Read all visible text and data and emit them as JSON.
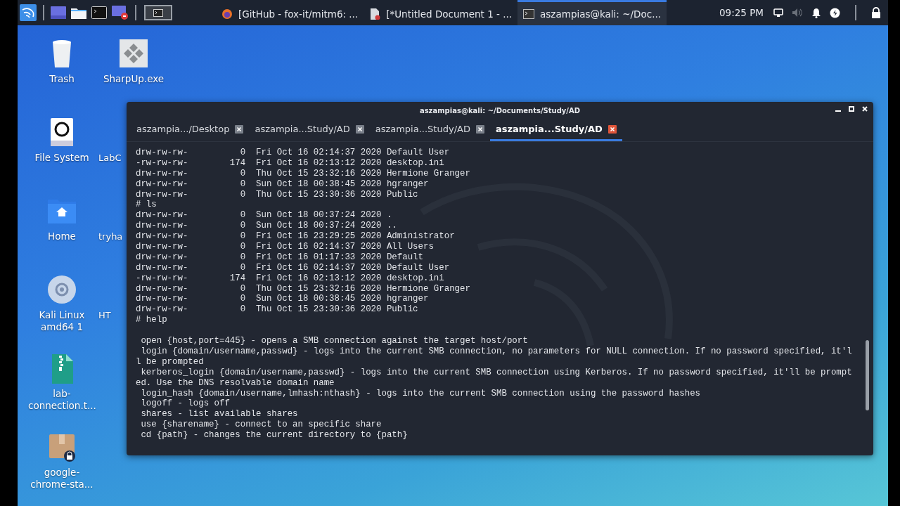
{
  "taskbar": {
    "tasks": [
      {
        "kind": "browser",
        "title": "[GitHub - fox-it/mitm6: ...",
        "selected": false
      },
      {
        "kind": "document",
        "title": "[*Untitled Document 1 - ...",
        "selected": false
      },
      {
        "kind": "terminal",
        "title": "aszampias@kali: ~/Doc...",
        "selected": true
      }
    ],
    "clock": "09:25 PM",
    "volume_muted": true
  },
  "desktop": {
    "column_1": [
      {
        "kind": "trash",
        "label": "Trash"
      },
      {
        "kind": "drive",
        "label": "File System"
      },
      {
        "kind": "home",
        "label": "Home"
      },
      {
        "kind": "disc",
        "label": "Kali Linux amd64 1"
      },
      {
        "kind": "archive",
        "label": "lab-connection.t..."
      },
      {
        "kind": "package",
        "label": "google-chrome-sta..."
      }
    ],
    "column_2": [
      {
        "kind": "exe",
        "label": "SharpUp.exe"
      },
      {
        "kind": "covered",
        "label": "LabC"
      },
      {
        "kind": "covered",
        "label": "tryha"
      },
      {
        "kind": "covered",
        "label": "HT"
      }
    ]
  },
  "terminal": {
    "title": "aszampias@kali: ~/Documents/Study/AD",
    "tabs": [
      {
        "label": "aszampia.../Desktop",
        "selected": false
      },
      {
        "label": "aszampia...Study/AD",
        "selected": false
      },
      {
        "label": "aszampia...Study/AD",
        "selected": false
      },
      {
        "label": "aszampia...Study/AD",
        "selected": true
      }
    ],
    "blocks": [
      {
        "lines": [
          "drw-rw-rw-          0  Fri Oct 16 02:14:37 2020 Default User",
          "-rw-rw-rw-        174  Fri Oct 16 02:13:12 2020 desktop.ini",
          "drw-rw-rw-          0  Thu Oct 15 23:32:16 2020 Hermione Granger",
          "drw-rw-rw-          0  Sun Oct 18 00:38:45 2020 hgranger",
          "drw-rw-rw-          0  Thu Oct 15 23:30:36 2020 Public",
          "# ls",
          "drw-rw-rw-          0  Sun Oct 18 00:37:24 2020 .",
          "drw-rw-rw-          0  Sun Oct 18 00:37:24 2020 ..",
          "drw-rw-rw-          0  Fri Oct 16 23:29:25 2020 Administrator",
          "drw-rw-rw-          0  Fri Oct 16 02:14:37 2020 All Users",
          "drw-rw-rw-          0  Fri Oct 16 01:17:33 2020 Default",
          "drw-rw-rw-          0  Fri Oct 16 02:14:37 2020 Default User",
          "-rw-rw-rw-        174  Fri Oct 16 02:13:12 2020 desktop.ini",
          "drw-rw-rw-          0  Thu Oct 15 23:32:16 2020 Hermione Granger",
          "drw-rw-rw-          0  Sun Oct 18 00:38:45 2020 hgranger",
          "drw-rw-rw-          0  Thu Oct 15 23:30:36 2020 Public",
          "# help"
        ]
      },
      {
        "lines": [
          " open {host,port=445} - opens a SMB connection against the target host/port",
          " login {domain/username,passwd} - logs into the current SMB connection, no parameters for NULL connection. If no password specified, it'l",
          "l be prompted",
          " kerberos_login {domain/username,passwd} - logs into the current SMB connection using Kerberos. If no password specified, it'll be prompt",
          "ed. Use the DNS resolvable domain name",
          " login_hash {domain/username,lmhash:nthash} - logs into the current SMB connection using the password hashes",
          " logoff - logs off",
          " shares - list available shares",
          " use {sharename} - connect to an specific share",
          " cd {path} - changes the current directory to {path}"
        ]
      }
    ]
  }
}
